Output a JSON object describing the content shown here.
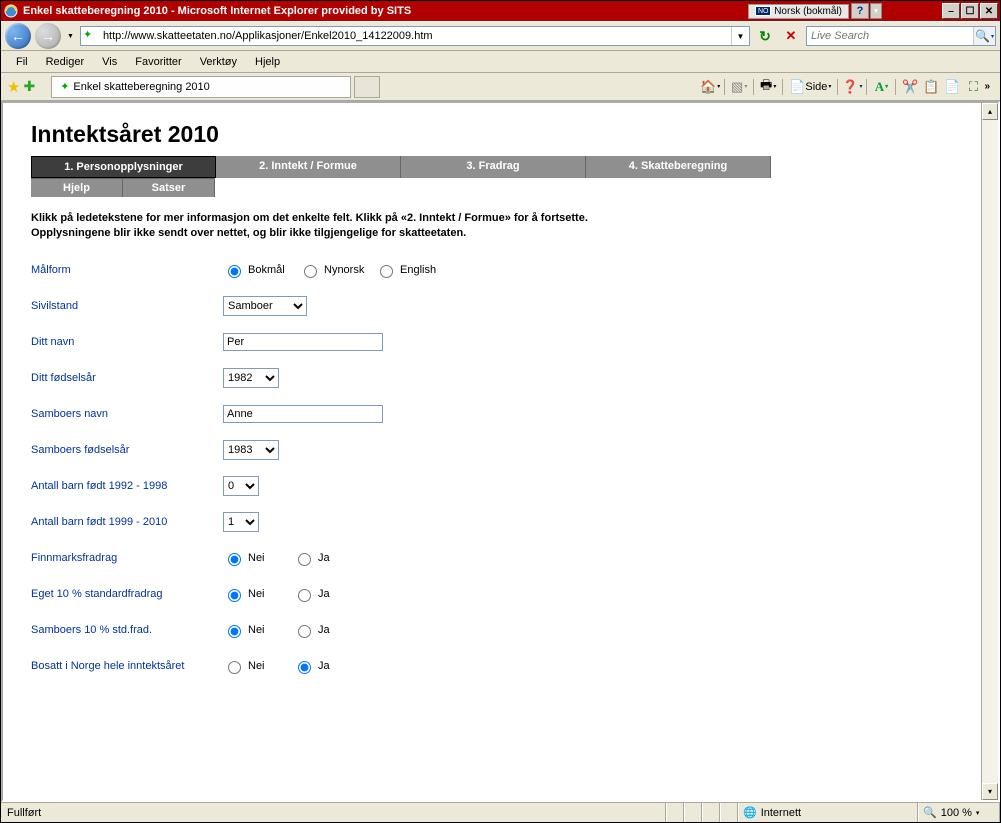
{
  "titlebar": {
    "text": "Enkel skatteberegning 2010 - Microsoft Internet Explorer provided by SITS",
    "lang_flag": "NO",
    "lang_label": "Norsk (bokmål)"
  },
  "address": {
    "url": "http://www.skatteetaten.no/Applikasjoner/Enkel2010_14122009.htm"
  },
  "search": {
    "placeholder": "Live Search"
  },
  "menus": {
    "file": "Fil",
    "edit": "Rediger",
    "view": "Vis",
    "favorites": "Favoritter",
    "tools": "Verktøy",
    "help": "Hjelp"
  },
  "tab": {
    "title": "Enkel skatteberegning 2010"
  },
  "toolbar": {
    "side_label": "Side"
  },
  "page": {
    "heading": "Inntektsåret 2010",
    "tabs": {
      "t1": "1. Personopplysninger",
      "t2": "2. Inntekt / Formue",
      "t3": "3. Fradrag",
      "t4": "4. Skatteberegning"
    },
    "subtabs": {
      "help": "Hjelp",
      "rates": "Satser"
    },
    "instr_line1": "Klikk på ledetekstene for mer informasjon om det enkelte felt. Klikk på «2. Inntekt / Formue» for å fortsette.",
    "instr_line2": "Opplysningene blir ikke sendt over nettet, og blir ikke tilgjengelige for skatteetaten."
  },
  "form": {
    "malform": {
      "label": "Målform",
      "opt_bokmal": "Bokmål",
      "opt_nynorsk": "Nynorsk",
      "opt_english": "English",
      "selected": "bokmal"
    },
    "sivilstand": {
      "label": "Sivilstand",
      "value": "Samboer"
    },
    "ditt_navn": {
      "label": "Ditt navn",
      "value": "Per"
    },
    "ditt_fodselsar": {
      "label": "Ditt fødselsår",
      "value": "1982"
    },
    "samboers_navn": {
      "label": "Samboers navn",
      "value": "Anne"
    },
    "samboers_fodselsar": {
      "label": "Samboers fødselsår",
      "value": "1983"
    },
    "barn_1992_1998": {
      "label": "Antall barn født 1992 - 1998",
      "value": "0"
    },
    "barn_1999_2010": {
      "label": "Antall barn født 1999 - 2010",
      "value": "1"
    },
    "finnmarksfradrag": {
      "label": "Finnmarksfradrag",
      "nei": "Nei",
      "ja": "Ja",
      "selected": "nei"
    },
    "eget_std": {
      "label": "Eget 10 % standardfradrag",
      "nei": "Nei",
      "ja": "Ja",
      "selected": "nei"
    },
    "samboers_std": {
      "label": "Samboers 10 % std.frad.",
      "nei": "Nei",
      "ja": "Ja",
      "selected": "nei"
    },
    "bosatt": {
      "label": "Bosatt i Norge hele inntektsåret",
      "nei": "Nei",
      "ja": "Ja",
      "selected": "ja"
    }
  },
  "status": {
    "text": "Fullført",
    "zone": "Internett",
    "zoom": "100 %"
  }
}
